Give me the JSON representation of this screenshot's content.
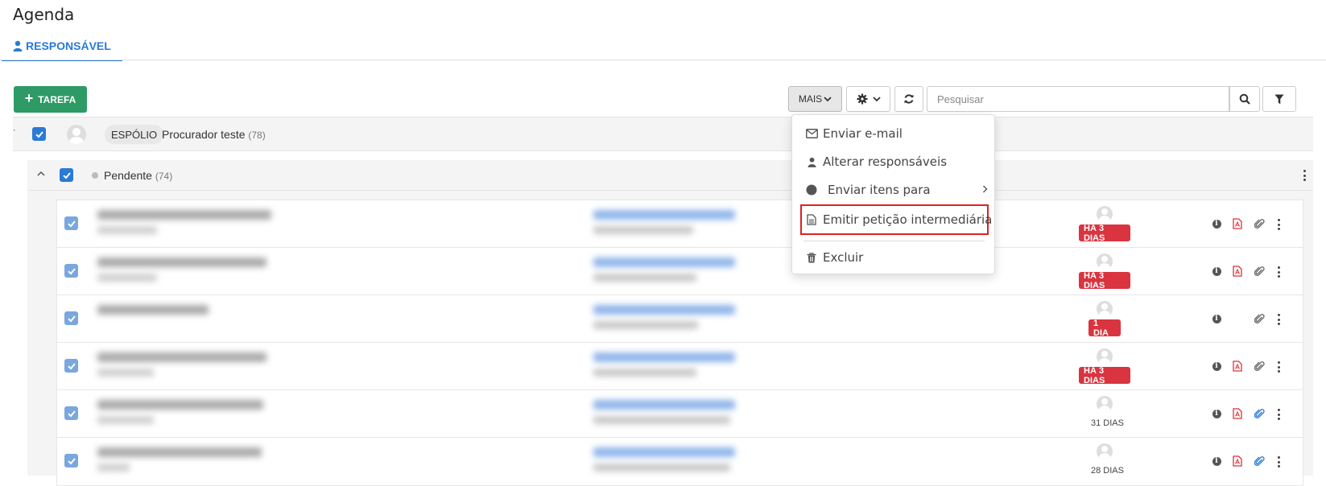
{
  "page": {
    "title": "Agenda"
  },
  "tabs": [
    {
      "label": "RESPONSÁVEL"
    }
  ],
  "toolbar": {
    "add_label": "TAREFA",
    "mais_label": "MAIS",
    "search_placeholder": "Pesquisar"
  },
  "group": {
    "tag": "ESPÓLIO",
    "name": "Procurador teste",
    "count": "(78)"
  },
  "subgroup": {
    "label": "Pendente",
    "count": "(74)"
  },
  "rows": [
    {
      "due": "HÁ 3 DIAS",
      "due_style": "badge",
      "pdf": true,
      "clip_color": "gray"
    },
    {
      "due": "HÁ 3 DIAS",
      "due_style": "badge",
      "pdf": true,
      "clip_color": "gray"
    },
    {
      "due": "1 DIA",
      "due_style": "badge",
      "pdf": false,
      "clip_color": "gray"
    },
    {
      "due": "HÁ 3 DIAS",
      "due_style": "badge",
      "pdf": true,
      "clip_color": "gray"
    },
    {
      "due": "31 DIAS",
      "due_style": "text",
      "pdf": true,
      "clip_color": "blue"
    },
    {
      "due": "28 DIAS",
      "due_style": "text",
      "pdf": true,
      "clip_color": "blue"
    }
  ],
  "menu": {
    "items": [
      {
        "label": "Enviar e-mail",
        "icon": "envelope-icon"
      },
      {
        "label": "Alterar responsáveis",
        "icon": "user-icon"
      },
      {
        "label": "Enviar itens para",
        "icon": "circle-icon"
      },
      {
        "label": "Emitir petição intermediária",
        "icon": "document-icon"
      },
      {
        "label": "Excluir",
        "icon": "trash-icon"
      }
    ]
  },
  "colors": {
    "accent": "#2a7ad6",
    "add_button": "#2e9a66",
    "badge_red": "#d9343f",
    "highlight": "#e02020"
  }
}
